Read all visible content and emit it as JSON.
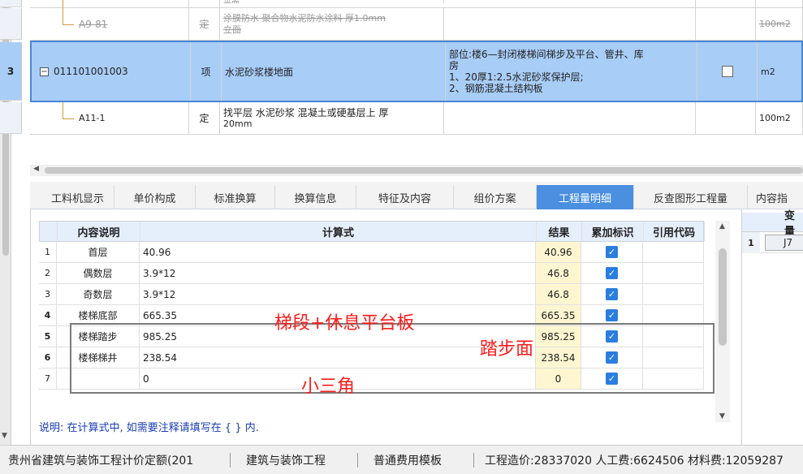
{
  "top_grid": {
    "rows": [
      {
        "num": "",
        "code": "",
        "type": "",
        "name": "平面",
        "desc": "",
        "unit": "",
        "struck": true
      },
      {
        "num": "",
        "code": "A9-81",
        "type": "定",
        "name_line1": "涂膜防水 聚合物水泥防水涂料 厚1.0mm",
        "name_line2": "立面",
        "desc": "",
        "unit": "100m2",
        "struck": true
      },
      {
        "num": "3",
        "code": "011101001003",
        "type": "项",
        "name": "水泥砂浆楼地面",
        "desc_lines": [
          "部位:楼6—封闭楼梯间梯步及平台、管井、库",
          "房",
          "1、20厚1:2.5水泥砂浆保护层;",
          "2、钢筋混凝土结构板"
        ],
        "unit": "m2",
        "selected": true
      },
      {
        "num": "",
        "code": "A11-1",
        "type": "定",
        "name_line1": "找平层 水泥砂浆 混凝土或硬基层上 厚",
        "name_line2": "20mm",
        "desc": "",
        "unit": "100m2"
      }
    ]
  },
  "tabs": [
    {
      "label": "工料机显示"
    },
    {
      "label": "单价构成"
    },
    {
      "label": "标准换算"
    },
    {
      "label": "换算信息"
    },
    {
      "label": "特征及内容"
    },
    {
      "label": "组价方案"
    },
    {
      "label": "工程量明细",
      "active": true
    },
    {
      "label": "反查图形工程量"
    },
    {
      "label": "内容指"
    }
  ],
  "detail_table": {
    "headers": {
      "desc": "内容说明",
      "formula": "计算式",
      "result": "结果",
      "accum": "累加标识",
      "ref": "引用代码"
    },
    "rows": [
      {
        "num": "1",
        "desc": "首层",
        "formula": "40.96",
        "result": "40.96",
        "checked": true
      },
      {
        "num": "2",
        "desc": "偶数层",
        "formula": "3.9*12",
        "result": "46.8",
        "checked": true
      },
      {
        "num": "3",
        "desc": "奇数层",
        "formula": "3.9*12",
        "result": "46.8",
        "checked": true
      },
      {
        "num": "4",
        "desc": "楼梯底部",
        "formula": "665.35",
        "result": "665.35",
        "checked": true
      },
      {
        "num": "5",
        "desc": "楼梯踏步",
        "formula": "985.25",
        "result": "985.25",
        "checked": true
      },
      {
        "num": "6",
        "desc": "楼梯梯井",
        "formula": "238.54",
        "result": "238.54",
        "checked": true
      },
      {
        "num": "7",
        "desc": "",
        "formula": "0",
        "result": "0",
        "checked": true
      }
    ],
    "note": "说明: 在计算式中, 如需要注释请填写在 { } 内."
  },
  "right_panel": {
    "header": "变量",
    "row_num": "1",
    "value": "J7"
  },
  "annotations": {
    "a1": "梯段+休息平台板",
    "a2": "踏步面",
    "a3": "小三角"
  },
  "status_bar": {
    "quota": "贵州省建筑与装饰工程计价定额(201",
    "project": "建筑与装饰工程",
    "template": "普通费用模板",
    "costs": "工程造价:28337020  人工费:6624506  材料费:12059287"
  }
}
